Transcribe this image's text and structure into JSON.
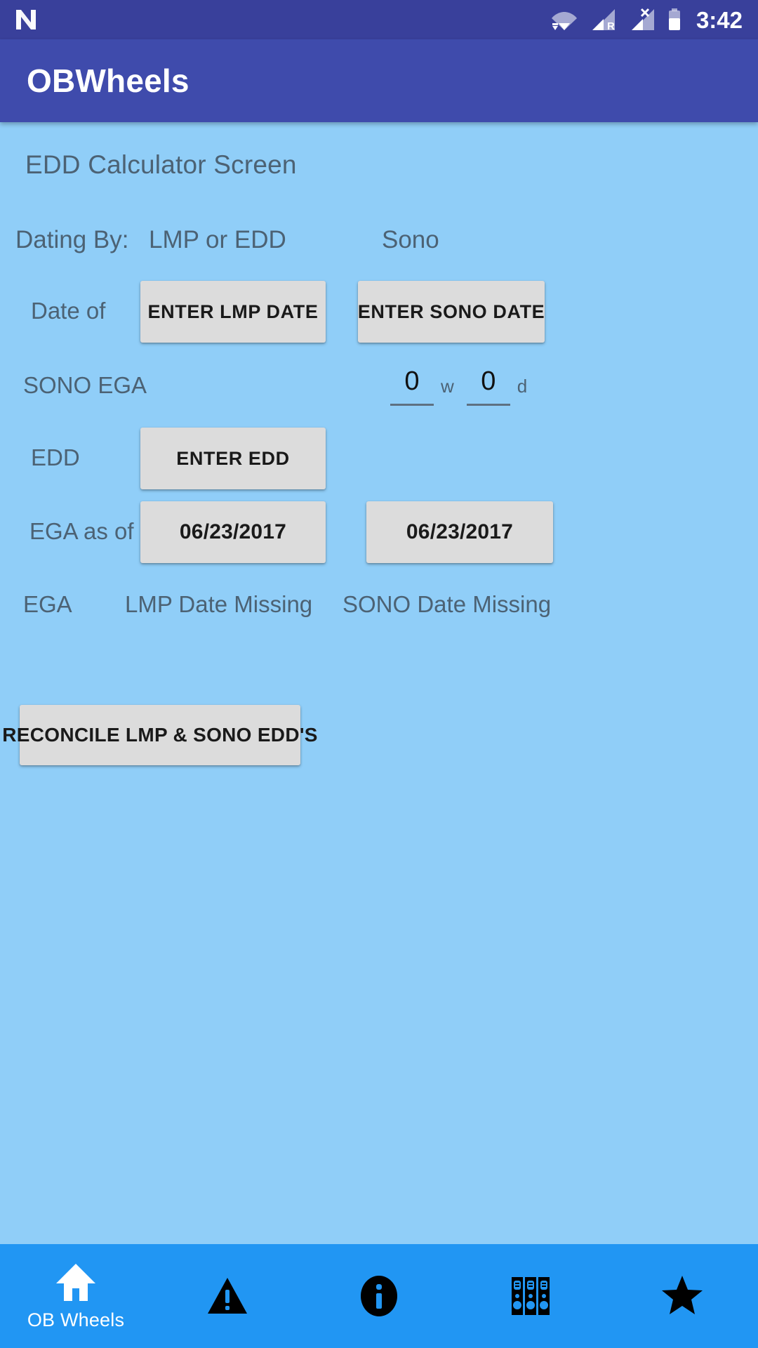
{
  "status_bar": {
    "time": "3:42",
    "icons": [
      {
        "name": "android-n-logo-icon"
      },
      {
        "name": "wifi-icon"
      },
      {
        "name": "signal-roaming-icon",
        "badge": "R"
      },
      {
        "name": "signal-no-sim-icon",
        "badge": "X"
      },
      {
        "name": "battery-icon"
      }
    ]
  },
  "app_bar": {
    "title": "OBWheels"
  },
  "screen": {
    "title": "EDD Calculator Screen"
  },
  "columns": {
    "label_header": "Dating By:",
    "col_a_header": "LMP or EDD",
    "col_b_header": "Sono"
  },
  "rows": {
    "date_of": {
      "label": "Date of",
      "lmp_button": "ENTER LMP DATE",
      "sono_button": "ENTER SONO DATE"
    },
    "sono_ega": {
      "label": "SONO EGA",
      "weeks_value": "0",
      "weeks_unit": "w",
      "days_value": "0",
      "days_unit": "d"
    },
    "edd": {
      "label": "EDD",
      "edd_button": "ENTER EDD"
    },
    "ega_as_of": {
      "label": "EGA as of",
      "lmp_date": "06/23/2017",
      "sono_date": "06/23/2017"
    },
    "ega": {
      "label": "EGA",
      "lmp_status": "LMP Date Missing",
      "sono_status": "SONO Date Missing"
    }
  },
  "actions": {
    "reconcile_button": "RECONCILE LMP & SONO EDD'S"
  },
  "bottom_nav": {
    "items": [
      {
        "icon": "home-icon",
        "label": "OB Wheels",
        "active": true
      },
      {
        "icon": "warning-triangle-icon",
        "label": "",
        "active": false
      },
      {
        "icon": "info-circle-icon",
        "label": "",
        "active": false
      },
      {
        "icon": "binders-library-icon",
        "label": "",
        "active": false
      },
      {
        "icon": "star-icon",
        "label": "",
        "active": false
      }
    ]
  },
  "colors": {
    "status_bar": "#39409B",
    "app_bar": "#3F4BAC",
    "content_bg": "#90CEF8",
    "bottom_nav": "#2196F3",
    "button_bg": "#DCDCDC",
    "label_text": "#4C6274"
  }
}
